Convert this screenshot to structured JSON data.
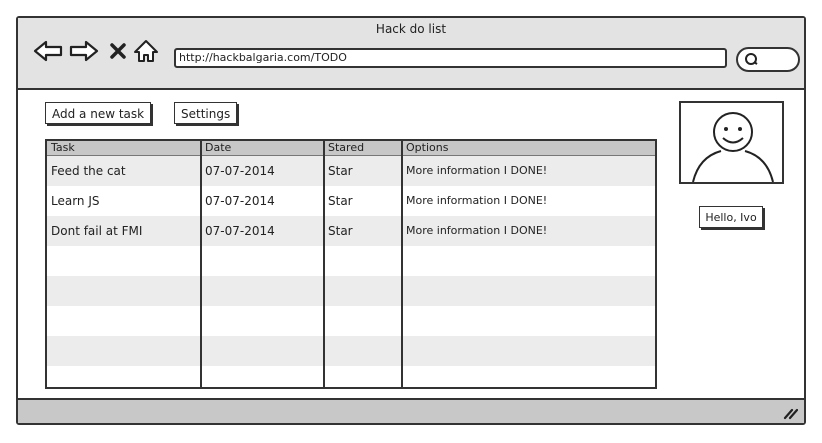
{
  "window": {
    "title": "Hack do list"
  },
  "nav": {
    "back_icon": "arrow-left-icon",
    "forward_icon": "arrow-right-icon",
    "stop_icon": "close-icon",
    "home_icon": "home-icon"
  },
  "address_bar": {
    "url": "http://hackbalgaria.com/TODO"
  },
  "search": {
    "icon": "search-icon"
  },
  "toolbar": {
    "add_label": "Add a new task",
    "settings_label": "Settings"
  },
  "table": {
    "columns": [
      "Task",
      "Date",
      "Stared",
      "Options"
    ],
    "rows": [
      {
        "task": "Feed the cat",
        "date": "07-07-2014",
        "stared": "Star",
        "options": "More information I DONE!"
      },
      {
        "task": "Learn JS",
        "date": "07-07-2014",
        "stared": "Star",
        "options": "More information I DONE!"
      },
      {
        "task": "Dont fail at FMI",
        "date": "07-07-2014",
        "stared": "Star",
        "options": "More information I DONE!"
      }
    ]
  },
  "profile": {
    "greeting": "Hello, Ivo",
    "avatar_icon": "smiley-avatar-icon"
  },
  "statusbar": {
    "grip_icon": "resize-grip-icon"
  },
  "colors": {
    "chrome": "#e3e3e3",
    "header_row": "#c7c7c7",
    "alt_row": "#ececec",
    "border": "#333333"
  }
}
